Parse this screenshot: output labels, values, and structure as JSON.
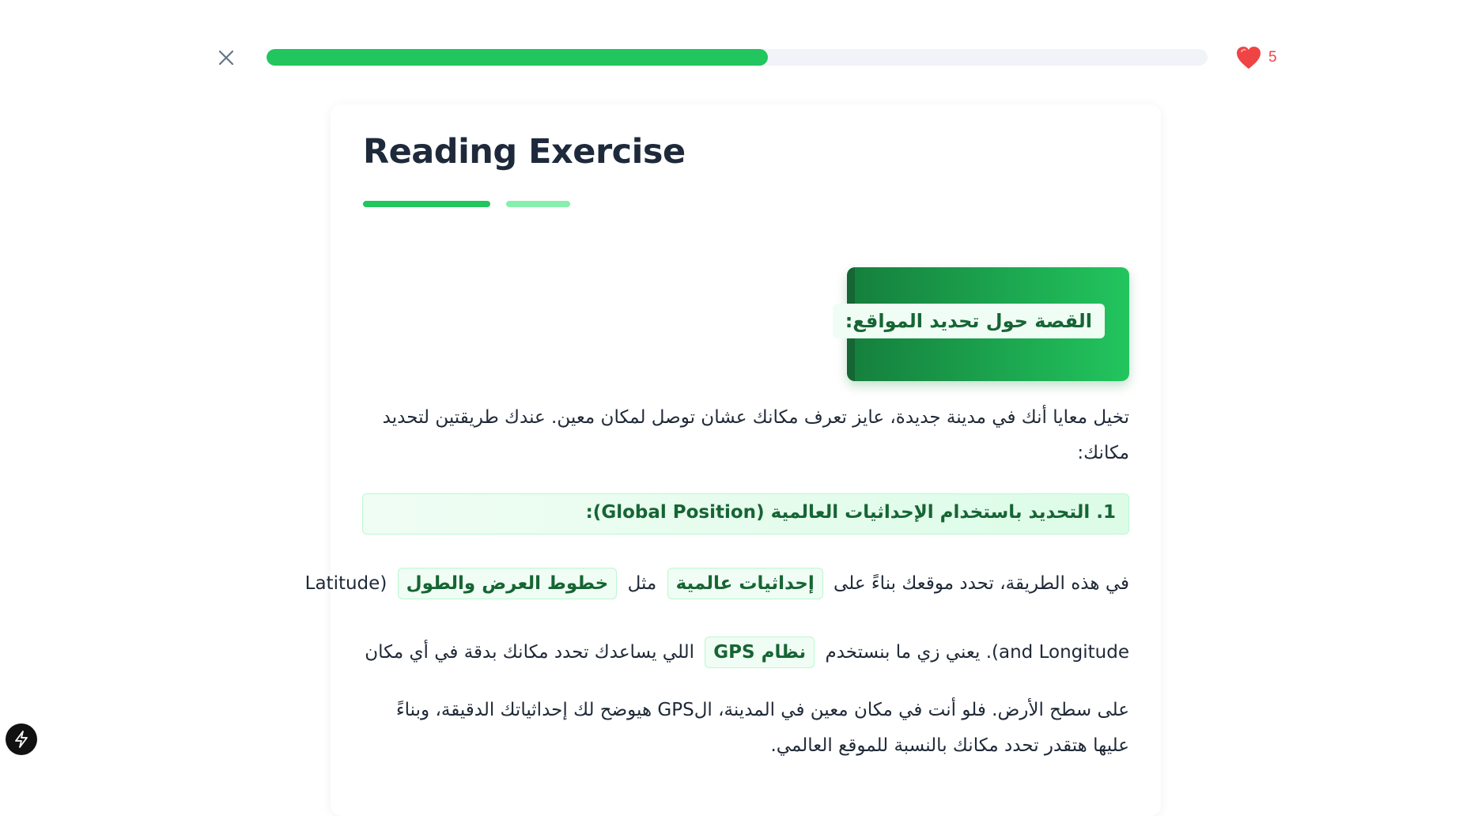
{
  "progress": {
    "fraction": 0.533
  },
  "hearts": {
    "count": "5"
  },
  "lesson": {
    "title": "Reading Exercise",
    "section_heading": "القصة حول تحديد المواقع:",
    "intro": "تخيل معايا أنك في مدينة جديدة، عايز تعرف مكانك عشان توصل لمكان معين. عندك طريقتين لتحديد مكانك:",
    "subheading": "1. التحديد باستخدام الإحداثيات العالمية (Global Position):",
    "line1": {
      "part1": "في هذه الطريقة، تحدد موقعك بناءً على",
      "hl1": "إحداثيات عالمية",
      "part2": "مثل",
      "hl2": "خطوط العرض والطول",
      "part3": "(Latitude"
    },
    "line2": {
      "part1": "and Longitude). يعني زي ما بنستخدم",
      "hl1": "نظام GPS",
      "part2": "اللي يساعدك تحدد مكانك بدقة في أي مكان"
    },
    "para3": "على سطح الأرض. فلو أنت في مكان معين في المدينة، الGPS هيوضح لك إحداثياتك الدقيقة، وبناءً عليها هتقدر تحدد مكانك بالنسبة للموقع العالمي."
  },
  "icons": {
    "close": "close-icon",
    "heart": "heart-icon",
    "bolt": "bolt-icon"
  },
  "colors": {
    "accent": "#22c55e",
    "accent_dark": "#15803d",
    "accent_light": "#86efac",
    "heart": "#ef4444"
  }
}
